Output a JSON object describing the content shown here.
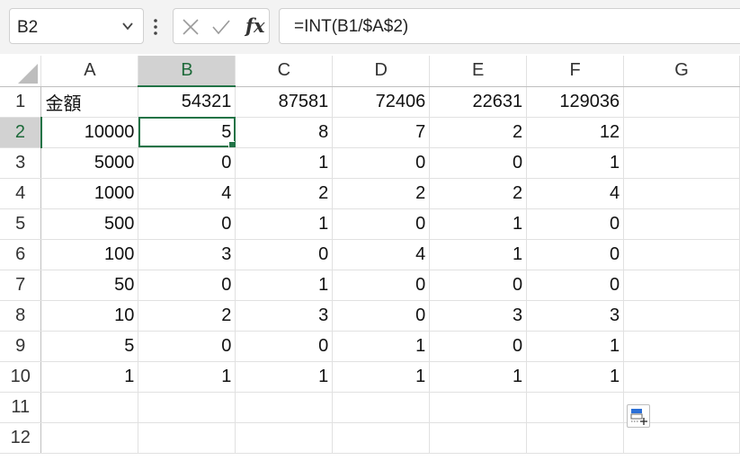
{
  "name_box": {
    "value": "B2"
  },
  "formula_bar": {
    "cancel_icon": "x-icon",
    "enter_icon": "check-icon",
    "fx_label": "fx",
    "formula": "=INT(B1/$A$2)"
  },
  "columns": [
    "A",
    "B",
    "C",
    "D",
    "E",
    "F",
    "G"
  ],
  "rows": [
    [
      "金額",
      "54321",
      "87581",
      "72406",
      "22631",
      "129036",
      ""
    ],
    [
      "10000",
      "5",
      "8",
      "7",
      "2",
      "12",
      ""
    ],
    [
      "5000",
      "0",
      "1",
      "0",
      "0",
      "1",
      ""
    ],
    [
      "1000",
      "4",
      "2",
      "2",
      "2",
      "4",
      ""
    ],
    [
      "500",
      "0",
      "1",
      "0",
      "1",
      "0",
      ""
    ],
    [
      "100",
      "3",
      "0",
      "4",
      "1",
      "0",
      ""
    ],
    [
      "50",
      "0",
      "1",
      "0",
      "0",
      "0",
      ""
    ],
    [
      "10",
      "2",
      "3",
      "0",
      "3",
      "3",
      ""
    ],
    [
      "5",
      "0",
      "0",
      "1",
      "0",
      "1",
      ""
    ],
    [
      "1",
      "1",
      "1",
      "1",
      "1",
      "1",
      ""
    ],
    [
      "",
      "",
      "",
      "",
      "",
      "",
      ""
    ],
    [
      "",
      "",
      "",
      "",
      "",
      "",
      ""
    ]
  ],
  "row_numbers": [
    "1",
    "2",
    "3",
    "4",
    "5",
    "6",
    "7",
    "8",
    "9",
    "10",
    "11",
    "12"
  ],
  "selection": {
    "cell": "B2",
    "accent_color": "#217346"
  },
  "autofill_options_icon": "autofill-options-icon"
}
